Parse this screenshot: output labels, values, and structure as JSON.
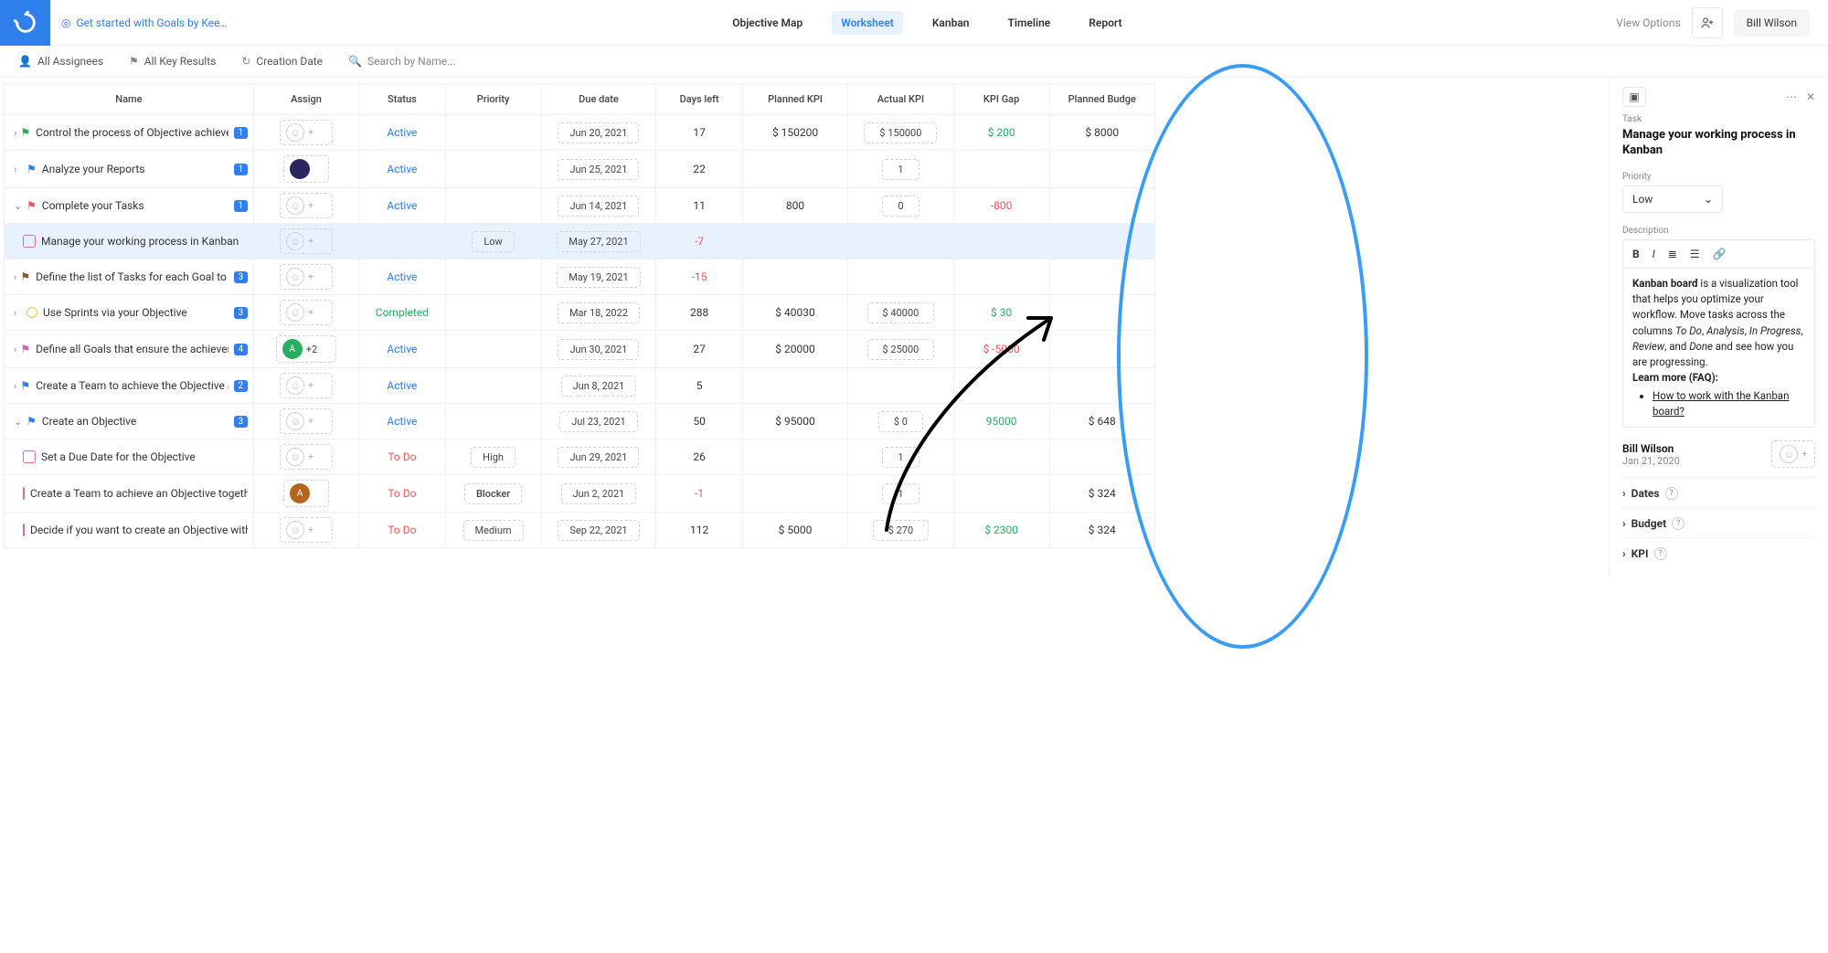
{
  "header": {
    "breadcrumb": "Get started with Goals by Kee…",
    "tabs": [
      "Objective Map",
      "Worksheet",
      "Kanban",
      "Timeline",
      "Report"
    ],
    "active_tab": "Worksheet",
    "view_options": "View Options",
    "user": "Bill Wilson"
  },
  "filters": {
    "assignees": "All Assignees",
    "keyresults": "All Key Results",
    "creation": "Creation Date",
    "search_placeholder": "Search by Name..."
  },
  "columns": [
    "Name",
    "Assign",
    "Status",
    "Priority",
    "Due date",
    "Days left",
    "Planned KPI",
    "Actual KPI",
    "KPI Gap",
    "Planned Budge"
  ],
  "rows": [
    {
      "chev": "›",
      "flag": "green",
      "name": "Control the process of Objective achievem…",
      "badge": "1",
      "assign": "empty",
      "status": "Active",
      "priority": "",
      "due": "Jun 20, 2021",
      "days": "17",
      "pkpi": "$ 150200",
      "akpi": "$ 150000",
      "gap": "$ 200",
      "gapClass": "pos-green",
      "budget": "$ 8000"
    },
    {
      "chev": "›",
      "flag": "blue",
      "name": "Analyze your Reports",
      "badge": "1",
      "assign": "avatar-purple",
      "status": "Active",
      "priority": "",
      "due": "Jun 25, 2021",
      "days": "22",
      "pkpi": "",
      "akpi": "1",
      "gap": "",
      "budget": ""
    },
    {
      "chev": "v",
      "flag": "red",
      "name": "Complete your Tasks",
      "badge": "1",
      "assign": "empty",
      "status": "Active",
      "priority": "",
      "due": "Jun 14, 2021",
      "days": "11",
      "pkpi": "800",
      "akpi": "0",
      "gap": "-800",
      "gapClass": "neg-red",
      "budget": ""
    },
    {
      "indent": true,
      "selected": true,
      "task": true,
      "name": "Manage your working process in Kanban",
      "assign": "empty",
      "status": "",
      "priority": "Low",
      "prioClass": "prio-low",
      "due": "May 27, 2021",
      "days": "-7",
      "daysClass": "neg-red",
      "pkpi": "",
      "akpi": "",
      "gap": "",
      "budget": ""
    },
    {
      "chev": "›",
      "flag": "brown",
      "name": "Define the list of Tasks for each Goal to ac…",
      "badge": "3",
      "assign": "empty",
      "status": "Active",
      "priority": "",
      "due": "May 19, 2021",
      "days": "-15",
      "daysClass": "neg-red",
      "pkpi": "",
      "akpi": "",
      "gap": "",
      "budget": ""
    },
    {
      "chev": "›",
      "obj": true,
      "name": "Use Sprints via your Objective",
      "badge": "3",
      "assign": "empty",
      "status": "Completed",
      "statusClass": "status-completed",
      "priority": "",
      "due": "Mar 18, 2022",
      "days": "288",
      "pkpi": "$ 40030",
      "akpi": "$ 40000",
      "gap": "$ 30",
      "gapClass": "pos-green",
      "budget": ""
    },
    {
      "chev": "›",
      "flag": "pink",
      "name": "Define all Goals that ensure the achieveme…",
      "badge": "4",
      "assign": "multi",
      "assignText": "+2",
      "status": "Active",
      "priority": "",
      "due": "Jun 30, 2021",
      "days": "27",
      "pkpi": "$ 20000",
      "akpi": "$ 25000",
      "gap": "$ -5000",
      "gapClass": "neg-red",
      "budget": ""
    },
    {
      "chev": "›",
      "flag": "blue",
      "name": "Create a Team to achieve the Objective and…",
      "badge": "2",
      "assign": "empty",
      "status": "Active",
      "priority": "",
      "due": "Jun 8, 2021",
      "days": "5",
      "pkpi": "",
      "akpi": "",
      "gap": "",
      "budget": ""
    },
    {
      "chev": "v",
      "flag": "blue",
      "name": "Create an Objective",
      "badge": "3",
      "assign": "empty",
      "status": "Active",
      "priority": "",
      "due": "Jul 23, 2021",
      "days": "50",
      "pkpi": "$ 95000",
      "akpi": "$ 0",
      "gap": "95000",
      "gapClass": "pos-green",
      "budget": "$ 648"
    },
    {
      "indent": true,
      "task": true,
      "name": "Set a Due Date for the Objective",
      "assign": "empty",
      "status": "To Do",
      "statusClass": "status-todo",
      "priority": "High",
      "prioClass": "prio-high",
      "due": "Jun 29, 2021",
      "days": "26",
      "pkpi": "",
      "akpi": "1",
      "gap": "",
      "budget": ""
    },
    {
      "indent": true,
      "task": true,
      "name": "Create a Team to achieve an Objective together",
      "assign": "avatar-brown",
      "status": "To Do",
      "statusClass": "status-todo",
      "priority": "Blocker",
      "prioClass": "prio-blocker",
      "due": "Jun 2, 2021",
      "days": "-1",
      "daysClass": "neg-red",
      "pkpi": "",
      "akpi": "1",
      "gap": "",
      "budget": "$ 324"
    },
    {
      "indent": true,
      "task": true,
      "name": "Decide if you want to create an Objective with or …",
      "assign": "empty",
      "status": "To Do",
      "statusClass": "status-todo",
      "priority": "Medium",
      "prioClass": "prio-medium",
      "due": "Sep 22, 2021",
      "days": "112",
      "pkpi": "$ 5000",
      "akpi": "$ 270",
      "gap": "$ 2300",
      "gapClass": "pos-green",
      "budget": "$ 324"
    }
  ],
  "panel": {
    "type_label": "Task",
    "title": "Manage your working process in Kanban",
    "priority_label": "Priority",
    "priority_value": "Low",
    "description_label": "Description",
    "desc_parts": {
      "bold": "Kanban board",
      "text1": " is a visualization tool that helps you optimize your workflow. Move tasks across the columns ",
      "i1": "To Do",
      "s1": ", ",
      "i2": "Analysis",
      "s2": ", ",
      "i3": "In Progress",
      "s3": ", ",
      "i4": "Review",
      "s4": ", and ",
      "i5": "Done",
      "text2": " and see how you are progressing.",
      "learn": "Learn more (FAQ):",
      "link": "How to work with the Kanban board?"
    },
    "creator_name": "Bill Wilson",
    "creator_date": "Jan 21, 2020",
    "sections": [
      "Dates",
      "Budget",
      "KPI"
    ]
  }
}
